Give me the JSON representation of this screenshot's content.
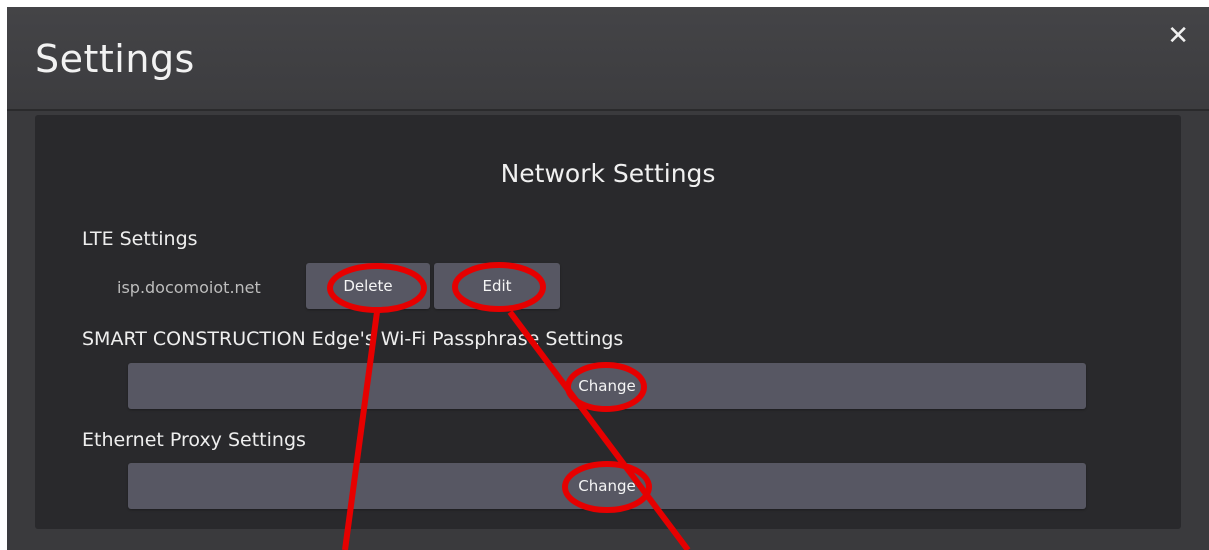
{
  "header": {
    "title": "Settings",
    "close_glyph": "✕"
  },
  "panel": {
    "title": "Network Settings",
    "lte": {
      "label": "LTE Settings",
      "apn": "isp.docomoiot.net",
      "delete_label": "Delete",
      "edit_label": "Edit"
    },
    "wifi": {
      "label": "SMART CONSTRUCTION Edge's Wi-Fi Passphrase Settings",
      "change_label": "Change"
    },
    "ethernet": {
      "label": "Ethernet Proxy Settings",
      "change_label": "Change"
    }
  },
  "annotations": {
    "color": "#e60000"
  }
}
